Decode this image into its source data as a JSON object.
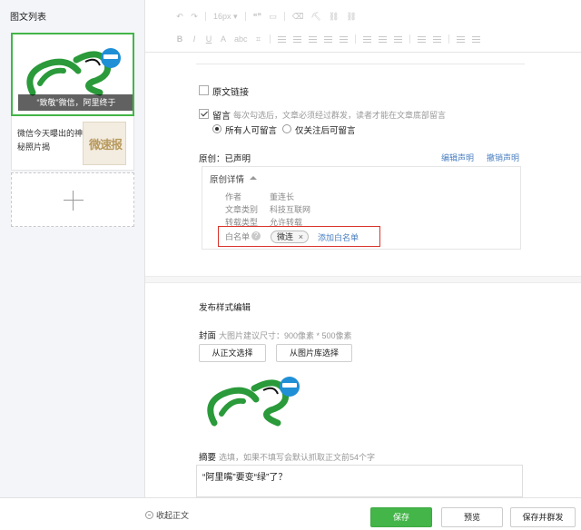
{
  "sidebar": {
    "title": "图文列表",
    "article1": {
      "caption": "“致敬”微信，阿里终于"
    },
    "article2": {
      "title": "微信今天曝出的神秘照片揭",
      "thumb_text": "微速报"
    },
    "colors": {
      "selected_border": "#43b548"
    }
  },
  "toolbar": {
    "row1": [
      "↶",
      "↷",
      "16px ▾",
      "❝❞",
      "▭",
      "⌫",
      "⛏",
      "⛓",
      "⛓"
    ],
    "row2": [
      "B",
      "I",
      "U",
      "A",
      "abc",
      "⌗",
      "≡",
      "≡",
      "≡",
      "≡",
      "≡",
      "≡",
      "≡",
      "≡"
    ]
  },
  "settings": {
    "source_link_label": "原文链接",
    "comment_label": "留言",
    "comment_hint": "每次勾选后，文章必须经过群发，读者才能在文章底部留言",
    "radio_all": "所有人可留言",
    "radio_follow": "仅关注后可留言",
    "original_status": "原创：已声明",
    "edit_declaration": "编辑声明",
    "revoke_declaration": "撤销声明",
    "details_title": "原创详情",
    "details": [
      {
        "k": "作者",
        "v": "董连长"
      },
      {
        "k": "文章类别",
        "v": "科技互联网"
      },
      {
        "k": "转载类型",
        "v": "允许转载"
      }
    ],
    "whitelist_label": "白名单",
    "whitelist_tag": "微连",
    "whitelist_add": "添加白名单"
  },
  "publish": {
    "section_title": "发布样式编辑",
    "cover_label": "封面",
    "cover_hint": "大图片建议尺寸：900像素 * 500像素",
    "from_body": "从正文选择",
    "from_library": "从图片库选择",
    "summary_label": "摘要",
    "summary_hint": "选填，如果不填写会默认抓取正文前54个字",
    "summary_value": "“阿里嘴”要变“绿”了？"
  },
  "footer": {
    "collapse": "收起正文",
    "save": "保存",
    "preview": "预览",
    "save_publish": "保存并群发",
    "save_color": "#44b549"
  }
}
